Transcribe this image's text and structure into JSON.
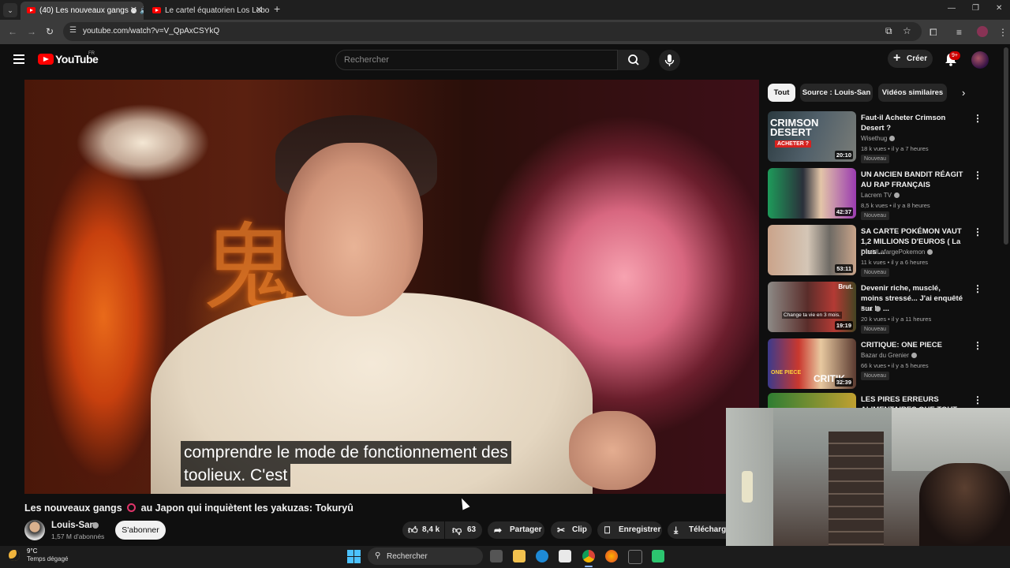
{
  "browser": {
    "tabs": [
      {
        "title": "(40) Les nouveaux gangs",
        "active": true
      },
      {
        "title": "Le cartel équatorien Los Lobos",
        "active": false
      }
    ],
    "url": "youtube.com/watch?v=V_QpAxCSYkQ"
  },
  "header": {
    "logo_text": "YouTube",
    "country_code": "FR",
    "search_placeholder": "Rechercher",
    "create_label": "Créer",
    "notifications": "9+"
  },
  "video": {
    "title_part1": "Les nouveaux gangs",
    "title_part2": "au Japon qui inquiètent les yakuzas: Tokuryû",
    "subtitle_line1": "comprendre le mode de fonctionnement des",
    "subtitle_line2": "toolieux. C'est",
    "channel": "Louis-San",
    "subscribers": "1,57 M d'abonnés",
    "subscribe_label": "S'abonner",
    "likes": "8,4 k",
    "dislikes": "63",
    "share_label": "Partager",
    "clip_label": "Clip",
    "save_label": "Enregistrer",
    "download_label": "Télécharger"
  },
  "sidebar": {
    "chips": [
      "Tout",
      "Source : Louis-San",
      "Vidéos similaires"
    ],
    "recommendations": [
      {
        "title": "Faut-il Acheter Crimson Desert ?",
        "channel": "Wisethug",
        "meta": "18 k vues • il y a 7 heures",
        "badge": "Nouveau",
        "duration": "20:10",
        "thumb_text": "CRIMSON DESERT",
        "thumb_sub": "ACHETER ?"
      },
      {
        "title": "UN ANCIEN BANDIT RÉAGIT AU RAP FRANÇAIS",
        "channel": "Lacrem TV",
        "meta": "8,5 k vues • il y a 8 heures",
        "badge": "Nouveau",
        "duration": "42:37"
      },
      {
        "title": "SA CARTE POKÉMON VAUT 1,2 MILLIONS D'EUROS ( La plus ...",
        "channel": "DavidLafargePokemon",
        "meta": "11 k vues • il y a 6 heures",
        "badge": "Nouveau",
        "duration": "53:11"
      },
      {
        "title": "Devenir riche, musclé, moins stressé... J'ai enquêté sur le ...",
        "channel": "Brut",
        "meta": "20 k vues • il y a 11 heures",
        "badge": "Nouveau",
        "duration": "19:19",
        "thumb_text": "Change ta vie en 3 mois.",
        "thumb_sub": "Brut."
      },
      {
        "title": "CRITIQUE: ONE PIECE",
        "channel": "Bazar du Grenier",
        "meta": "66 k vues • il y a 5 heures",
        "badge": "Nouveau",
        "duration": "32:39",
        "thumb_text": "CRITIK",
        "thumb_sub": "ONE PIECE"
      },
      {
        "title": "LES PIRES ERREURS ALIMENTAIRES QUE TOUT LE ...",
        "channel": "",
        "meta": "",
        "badge": "",
        "duration": ""
      }
    ]
  },
  "taskbar": {
    "temperature": "9°C",
    "weather": "Temps dégagé",
    "search_label": "Rechercher"
  },
  "colors": {
    "youtube_red": "#ff0000",
    "background": "#0f0f0f",
    "chip_bg": "#272727"
  }
}
